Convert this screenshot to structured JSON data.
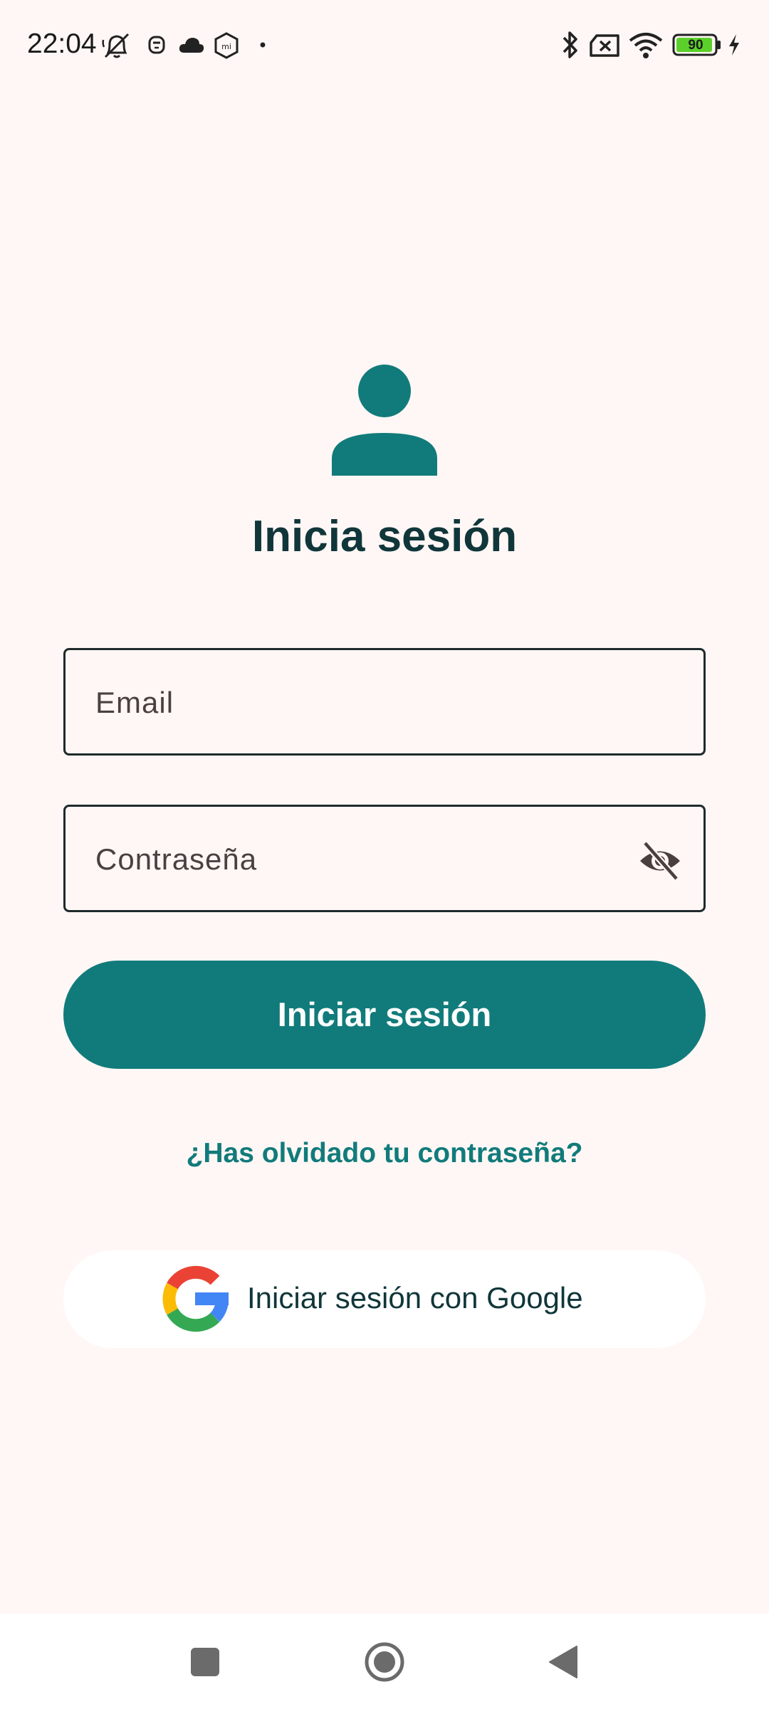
{
  "status_bar": {
    "time": "22:04",
    "battery": "90"
  },
  "login": {
    "title": "Inicia sesión",
    "email_placeholder": "Email",
    "password_placeholder": "Contraseña",
    "submit_label": "Iniciar sesión",
    "forgot_password": "¿Has olvidado tu contraseña?",
    "google_label": "Iniciar sesión con Google"
  },
  "colors": {
    "background": "#FFF7F5",
    "accent": "#117B7B",
    "title": "#10363A"
  },
  "icons": {
    "avatar": "person-icon",
    "password_toggle": "eye-off-icon",
    "google": "google-logo-icon",
    "nav": [
      "recents-square-icon",
      "home-circle-icon",
      "back-triangle-icon"
    ]
  }
}
